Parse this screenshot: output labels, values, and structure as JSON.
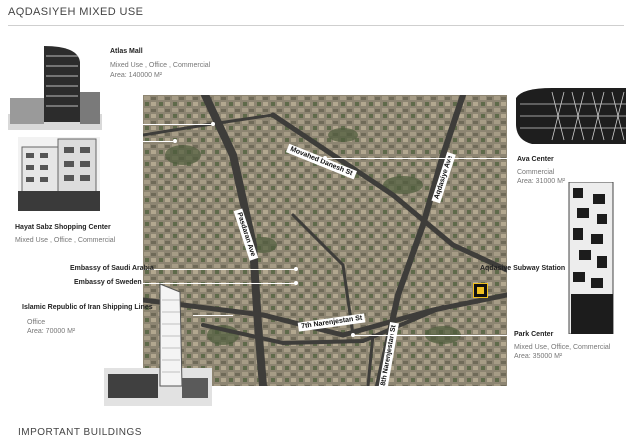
{
  "title": "AQDASIYEH MIXED USE",
  "footer": "IMPORTANT BUILDINGS",
  "buildings": {
    "atlas": {
      "name": "Atlas Mall",
      "use": "Mixed Use , Office , Commercial",
      "area": "Area: 140000 M²"
    },
    "hayat": {
      "name": "Hayat Sabz Shopping Center",
      "use": "Mixed Use , Office , Commercial"
    },
    "saudi": {
      "name": "Embassy of Saudi Arabia"
    },
    "sweden": {
      "name": "Embassy of  Sweden"
    },
    "shipping": {
      "name": "Islamic Republic of Iran Shipping Lines",
      "use": "Office",
      "area": "Area: 70000 M²"
    },
    "ava": {
      "name": "Ava Center",
      "use": "Commercial",
      "area": "Area: 31000 M²"
    },
    "subway": {
      "name": "Aqdasiye Subway Station"
    },
    "park": {
      "name": "Park Center",
      "use": "Mixed Use, Office, Commercial",
      "area": "Area: 35000 M²"
    }
  },
  "streets": {
    "movahed": "Movahed Danesh St",
    "aqdasiye": "Aqdasiye Ave",
    "pasdaran": "Pasdaran Ave",
    "narenjestan7": "7th Narenjestan St",
    "narenjestan8": "8th Narenjestan St"
  }
}
